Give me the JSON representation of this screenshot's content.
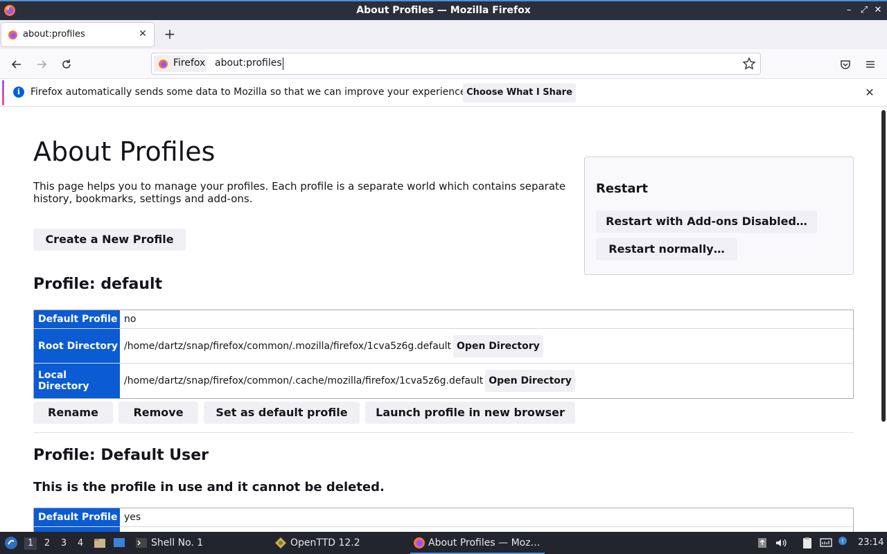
{
  "window": {
    "title": "About Profiles — Mozilla Firefox"
  },
  "tabs": [
    {
      "label": "about:profiles"
    }
  ],
  "urlbar": {
    "identity_label": "Firefox",
    "url": "about:profiles"
  },
  "notification": {
    "text": "Firefox automatically sends some data to Mozilla so that we can improve your experience.",
    "button_label": "Choose What I Share"
  },
  "page": {
    "title": "About Profiles",
    "intro": "This page helps you to manage your profiles. Each profile is a separate world which contains separate history, bookmarks, settings and add-ons.",
    "create_button": "Create a New Profile",
    "restart": {
      "title": "Restart",
      "addons_disabled_button": "Restart with Add-ons Disabled…",
      "normal_button": "Restart normally…"
    },
    "profiles": [
      {
        "heading": "Profile: default",
        "rows": [
          {
            "key": "Default Profile",
            "value": "no"
          },
          {
            "key": "Root Directory",
            "value": "/home/dartz/snap/firefox/common/.mozilla/firefox/1cva5z6g.default",
            "button": "Open Directory"
          },
          {
            "key": "Local Directory",
            "value": "/home/dartz/snap/firefox/common/.cache/mozilla/firefox/1cva5z6g.default",
            "button": "Open Directory"
          }
        ],
        "actions": [
          "Rename",
          "Remove",
          "Set as default profile",
          "Launch profile in new browser"
        ]
      },
      {
        "heading": "Profile: Default User",
        "note": "This is the profile in use and it cannot be deleted.",
        "rows": [
          {
            "key": "Default Profile",
            "value": "yes"
          }
        ]
      }
    ]
  },
  "taskbar": {
    "workspaces": [
      "1",
      "2",
      "3",
      "4"
    ],
    "active_workspace": "1",
    "items": [
      {
        "label": "Shell No. 1",
        "icon": "terminal-icon"
      },
      {
        "label": "OpenTTD 12.2",
        "icon": "openttd-icon"
      },
      {
        "label": "About Profiles — Moz…",
        "icon": "firefox-icon"
      }
    ],
    "clock": "23:14"
  },
  "colors": {
    "accent": "#0b5bd3",
    "taskbar_bg": "#22252e",
    "titlebar_bg": "#2b2e3b"
  }
}
